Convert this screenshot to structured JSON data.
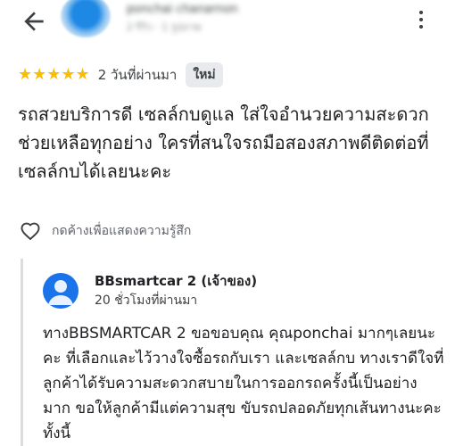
{
  "header": {
    "reviewer_name": "ponchai chanarnon",
    "reviewer_meta": "2 รีวิว · 1 รูปภาพ"
  },
  "review": {
    "stars": "★★★★★",
    "rating": 5,
    "time": "2 วันที่ผ่านมา",
    "badge": "ใหม่",
    "text": "รถสวยบริการดี เซลล์กบดูแล ใส่ใจอำนวยความสะดวกช่วยเหลือทุกอย่าง ใครที่สนใจรถมือสองสภาพดีติดต่อที่เซลล์กบได้เลยนะคะ"
  },
  "reaction": {
    "label": "กดค้างเพื่อแสดงความรู้สึก"
  },
  "reply": {
    "owner_name": "BBsmartcar 2 (เจ้าของ)",
    "time": "20 ชั่วโมงที่ผ่านมา",
    "text": "ทางBBSMARTCAR 2 ขอขอบคุณ คุณponchai มากๆเลยนะคะ ที่เลือกและไว้วางใจซื้อรถกับเรา และเซลล์กบ ทางเราดีใจที่ลูกค้าได้รับความสะดวกสบายในการออกรถครั้งนี้เป็นอย่างมาก ขอให้ลูกค้ามีแต่ความสุข ขับรถปลอดภัยทุกเส้นทางนะคะ ทั้งนี้"
  },
  "colors": {
    "star": "#fbbc04",
    "owner_avatar": "#1a73e8",
    "badge_bg": "#e8eaed"
  }
}
